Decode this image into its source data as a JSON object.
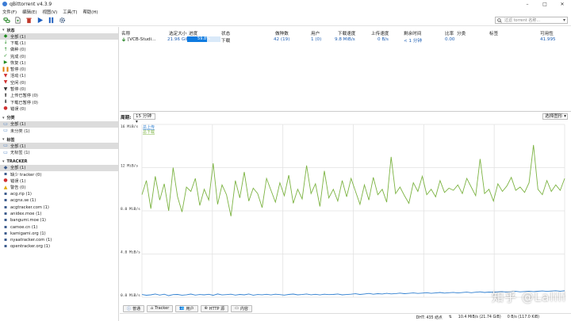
{
  "window": {
    "title": "qBittorrent v4.3.9",
    "minimize": "–",
    "maximize": "□",
    "close": "✕"
  },
  "menu": [
    "文件(F)",
    "编辑(E)",
    "视图(V)",
    "工具(T)",
    "帮助(H)"
  ],
  "toolbar": {
    "search_placeholder": "过滤 torrent 名称..."
  },
  "sidebar": {
    "status": {
      "header": "状态",
      "items": [
        {
          "label": "全部 (1)",
          "icon": "all-icon",
          "color": "#1e8a1e"
        },
        {
          "label": "下载 (1)",
          "icon": "download-icon",
          "color": "#1e8a1e"
        },
        {
          "label": "做种 (0)",
          "icon": "upload-icon",
          "color": "#1e8a1e"
        },
        {
          "label": "完成 (0)",
          "icon": "check-icon",
          "color": "#1e8a1e"
        },
        {
          "label": "恢复 (1)",
          "icon": "play-icon",
          "color": "#1e8a1e"
        },
        {
          "label": "暂停 (0)",
          "icon": "pause-icon",
          "color": "#e07a00"
        },
        {
          "label": "活动 (1)",
          "icon": "filter-icon",
          "color": "#d03030"
        },
        {
          "label": "空闲 (0)",
          "icon": "filter-icon",
          "color": "#d03030"
        },
        {
          "label": "暂停 (0)",
          "icon": "filter-icon",
          "color": "#333333"
        },
        {
          "label": "上传已暂停 (0)",
          "icon": "arrow-up-icon",
          "color": "#333333"
        },
        {
          "label": "下载已暂停 (0)",
          "icon": "arrow-down-icon",
          "color": "#333333"
        },
        {
          "label": "错误 (0)",
          "icon": "error-icon",
          "color": "#d03030"
        }
      ]
    },
    "category": {
      "header": "分类",
      "items": [
        {
          "label": "全部 (1)",
          "icon": "folder-icon"
        },
        {
          "label": "未分类 (1)",
          "icon": "folder-icon"
        }
      ]
    },
    "tags": {
      "header": "标签",
      "items": [
        {
          "label": "全部 (1)",
          "icon": "folder-icon"
        },
        {
          "label": "无标签 (1)",
          "icon": "folder-icon"
        }
      ]
    },
    "trackers": {
      "header": "TRACKER",
      "items": [
        {
          "label": "全部 (1)",
          "icon": "all-icon"
        },
        {
          "label": "缺少 tracker (0)",
          "icon": "tracker-icon"
        },
        {
          "label": "错误 (1)",
          "icon": "error-icon"
        },
        {
          "label": "警告 (0)",
          "icon": "warning-icon"
        },
        {
          "label": "acg.rip (1)",
          "icon": "tracker-icon"
        },
        {
          "label": "acgnx.se (1)",
          "icon": "tracker-icon"
        },
        {
          "label": "acgtracker.com (1)",
          "icon": "tracker-icon"
        },
        {
          "label": "anidex.moe (1)",
          "icon": "tracker-icon"
        },
        {
          "label": "bangumi.moe (1)",
          "icon": "tracker-icon"
        },
        {
          "label": "camoe.cn (1)",
          "icon": "tracker-icon"
        },
        {
          "label": "kamigami.org (1)",
          "icon": "tracker-icon"
        },
        {
          "label": "nyaatracker.com (1)",
          "icon": "tracker-icon"
        },
        {
          "label": "opentracker.org (1)",
          "icon": "tracker-icon"
        }
      ]
    }
  },
  "table": {
    "headers": [
      "名称",
      "选定大小",
      "进度",
      "状态",
      "做种数",
      "用户",
      "下载速度",
      "上传速度",
      "剩余时间",
      "比率",
      "分类",
      "标签",
      "可用性"
    ],
    "rows": [
      {
        "name": "[VCB-Studi...",
        "size": "21.96 GiB",
        "progress": "59.8%",
        "progress_fraction": 0.598,
        "status": "下载",
        "seeds": "42 (19)",
        "peers": "1 (0)",
        "down": "9.8 MiB/s",
        "up": "0 B/s",
        "eta": "< 1 分钟",
        "ratio": "0.00",
        "category": "",
        "tags": "",
        "availability": "41.995"
      }
    ]
  },
  "graph": {
    "label": "周期:",
    "period": "15 分钟",
    "select_right": "选择图形"
  },
  "chart_data": {
    "type": "line",
    "yticks": [
      "16 MiB/s",
      "12 MiB/s",
      "8.0 MiB/s",
      "4.0 MiB/s",
      "0.0 MiB/s"
    ],
    "ylim": [
      0,
      16
    ],
    "legend": [
      "总上传",
      "总下载"
    ],
    "series": [
      {
        "name": "总下载",
        "color": "#7cb342",
        "values": [
          9.5,
          10.8,
          8.2,
          11.2,
          9.0,
          10.5,
          8.0,
          12.0,
          9.3,
          7.9,
          10.2,
          9.8,
          11.0,
          8.5,
          10.0,
          9.0,
          12.4,
          8.6,
          10.4,
          9.5,
          7.5,
          10.8,
          9.2,
          11.6,
          8.9,
          10.1,
          9.6,
          8.3,
          11.0,
          9.9,
          8.8,
          10.6,
          9.4,
          11.3,
          8.7,
          10.0,
          9.1,
          12.2,
          9.6,
          10.5,
          8.4,
          11.7,
          9.2,
          10.0,
          8.9,
          10.8,
          9.3,
          11.0,
          9.8,
          8.6,
          10.4,
          9.0,
          11.1,
          9.5,
          10.0,
          8.8,
          13.0,
          9.6,
          10.2,
          9.4,
          8.7,
          10.6,
          9.8,
          11.2,
          9.5,
          10.0,
          9.3,
          10.8,
          9.7,
          10.1,
          9.9,
          10.4,
          9.6,
          11.0,
          10.2,
          9.4,
          12.8,
          9.6,
          10.0,
          8.9,
          10.5,
          9.8,
          10.3,
          11.1,
          9.9,
          10.2,
          9.7,
          10.6,
          14.1,
          10.0,
          9.5,
          10.8,
          9.8,
          10.4,
          9.9,
          11.0
        ]
      },
      {
        "name": "总上传",
        "color": "#2f7fd0",
        "values": [
          0.25,
          0.18,
          0.22,
          0.3,
          0.2,
          0.28,
          0.15,
          0.24,
          0.26,
          0.19,
          0.23,
          0.29,
          0.2,
          0.25,
          0.22,
          0.27,
          0.18,
          0.3,
          0.21,
          0.24,
          0.28,
          0.2,
          0.26,
          0.22,
          0.3,
          0.19,
          0.25,
          0.23,
          0.27,
          0.21,
          0.28,
          0.24,
          0.2,
          0.26,
          0.29,
          0.22,
          0.25,
          0.3,
          0.23,
          0.27,
          0.21,
          0.28,
          0.24,
          0.26,
          0.3,
          0.22,
          0.25,
          0.28,
          0.32,
          0.26,
          0.3,
          0.35,
          0.28,
          0.33,
          0.3,
          0.36,
          0.31,
          0.34,
          0.38,
          0.33,
          0.36,
          0.4,
          0.35,
          0.38,
          0.42,
          0.36,
          0.4,
          0.44,
          0.38,
          0.42,
          0.45,
          0.4,
          0.43,
          0.47,
          0.42,
          0.46,
          0.5,
          0.44,
          0.48,
          0.46,
          0.5,
          0.52,
          0.48,
          0.5,
          0.54,
          0.5,
          0.53,
          0.56,
          0.52,
          0.55,
          0.58,
          0.54,
          0.57,
          0.6,
          0.56,
          0.6
        ]
      }
    ]
  },
  "bottom_tabs": [
    "普通",
    "Tracker",
    "用户",
    "HTTP 源",
    "内容"
  ],
  "statusbar": {
    "dht": "DHT: 435 结点",
    "down": "10.4 MiB/s (21.74 GiB)",
    "up": "0 B/s (117.0 KiB)"
  },
  "watermark": "知乎 @Lalili"
}
